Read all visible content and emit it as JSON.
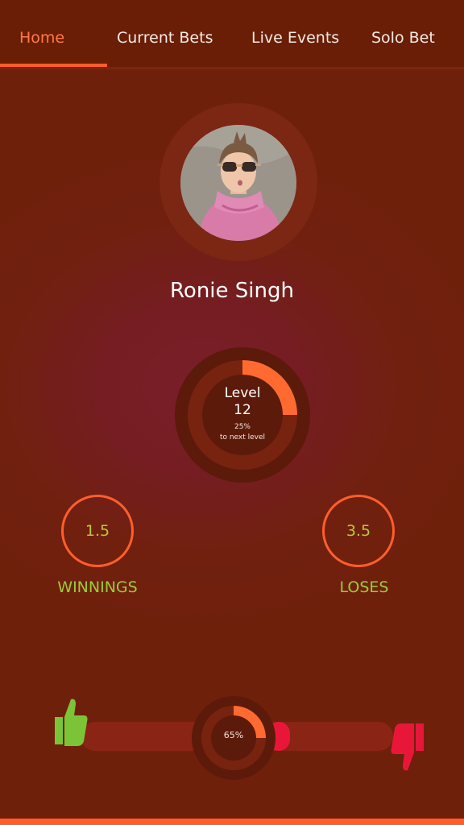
{
  "nav": {
    "tabs": [
      {
        "label": "Home",
        "active": true
      },
      {
        "label": "Current Bets",
        "active": false
      },
      {
        "label": "Live Events",
        "active": false
      },
      {
        "label": "Solo Bet",
        "active": false
      }
    ]
  },
  "profile": {
    "name": "Ronie Singh"
  },
  "level": {
    "label": "Level",
    "number": "12",
    "progress_text": "25%",
    "progress_fraction": 0.25,
    "caption": "to next level"
  },
  "stats": {
    "winnings": {
      "value": "1.5",
      "label": "WINNINGS"
    },
    "loses": {
      "value": "3.5",
      "label": "LOSES"
    }
  },
  "meter": {
    "percent_text": "65%",
    "fraction": 0.65
  },
  "colors": {
    "accent": "#ff5e2b",
    "win_green": "#7cc437",
    "lose_red": "#e8173a",
    "label_green": "#9ccc3a"
  },
  "icons": {
    "like": "thumbs-up-icon",
    "dislike": "thumbs-down-icon"
  }
}
